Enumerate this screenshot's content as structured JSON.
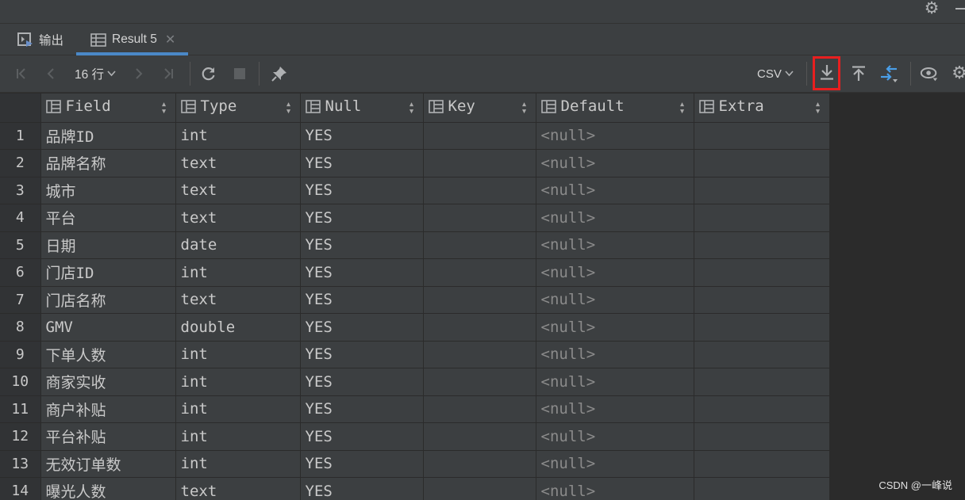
{
  "window": {
    "settings_icon": "gear-icon",
    "minimize_icon": "minimize-icon"
  },
  "tabs": [
    {
      "label": "输出",
      "icon": "console-output-icon",
      "active": false
    },
    {
      "label": "Result 5",
      "icon": "table-icon",
      "active": true,
      "close_icon": "close-icon"
    }
  ],
  "toolbar": {
    "rows_label": "16 行",
    "export_format": "CSV",
    "buttons": [
      "first-page-icon",
      "previous-page-icon",
      "next-page-icon",
      "last-page-icon",
      "refresh-icon",
      "stop-icon",
      "pin-icon",
      "download-icon",
      "upload-icon",
      "compare-icon",
      "view-icon",
      "settings-icon"
    ],
    "highlight_color": "#e81f1f"
  },
  "grid": {
    "columns": [
      "Field",
      "Type",
      "Null",
      "Key",
      "Default",
      "Extra"
    ],
    "rows": [
      {
        "num": "1",
        "field": "品牌ID",
        "type": "int",
        "null": "YES",
        "key": "",
        "default": "<null>",
        "extra": ""
      },
      {
        "num": "2",
        "field": "品牌名称",
        "type": "text",
        "null": "YES",
        "key": "",
        "default": "<null>",
        "extra": ""
      },
      {
        "num": "3",
        "field": "城市",
        "type": "text",
        "null": "YES",
        "key": "",
        "default": "<null>",
        "extra": ""
      },
      {
        "num": "4",
        "field": "平台",
        "type": "text",
        "null": "YES",
        "key": "",
        "default": "<null>",
        "extra": ""
      },
      {
        "num": "5",
        "field": "日期",
        "type": "date",
        "null": "YES",
        "key": "",
        "default": "<null>",
        "extra": ""
      },
      {
        "num": "6",
        "field": "门店ID",
        "type": "int",
        "null": "YES",
        "key": "",
        "default": "<null>",
        "extra": ""
      },
      {
        "num": "7",
        "field": "门店名称",
        "type": "text",
        "null": "YES",
        "key": "",
        "default": "<null>",
        "extra": ""
      },
      {
        "num": "8",
        "field": "GMV",
        "type": "double",
        "null": "YES",
        "key": "",
        "default": "<null>",
        "extra": ""
      },
      {
        "num": "9",
        "field": "下单人数",
        "type": "int",
        "null": "YES",
        "key": "",
        "default": "<null>",
        "extra": ""
      },
      {
        "num": "10",
        "field": "商家实收",
        "type": "int",
        "null": "YES",
        "key": "",
        "default": "<null>",
        "extra": ""
      },
      {
        "num": "11",
        "field": "商户补贴",
        "type": "int",
        "null": "YES",
        "key": "",
        "default": "<null>",
        "extra": ""
      },
      {
        "num": "12",
        "field": "平台补贴",
        "type": "int",
        "null": "YES",
        "key": "",
        "default": "<null>",
        "extra": ""
      },
      {
        "num": "13",
        "field": "无效订单数",
        "type": "int",
        "null": "YES",
        "key": "",
        "default": "<null>",
        "extra": ""
      },
      {
        "num": "14",
        "field": "曝光人数",
        "type": "text",
        "null": "YES",
        "key": "",
        "default": "<null>",
        "extra": ""
      }
    ]
  },
  "watermark": "CSDN @一峰说"
}
